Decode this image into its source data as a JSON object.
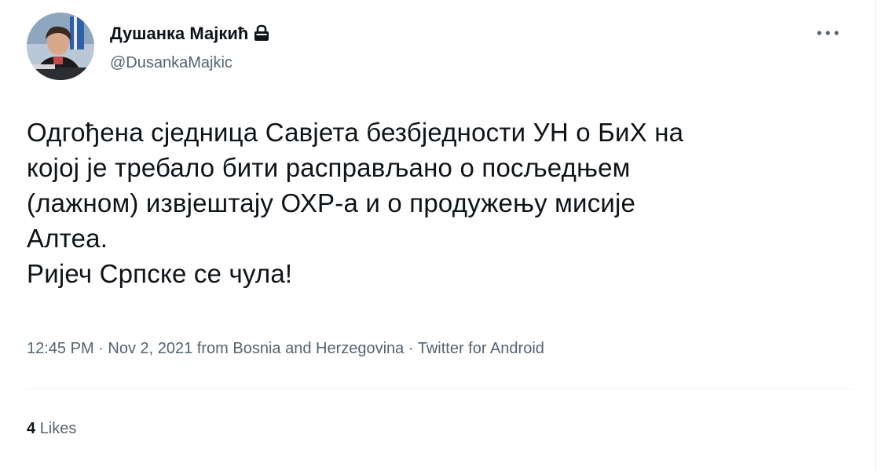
{
  "author": {
    "display_name": "Душанка Мајкић",
    "handle": "@DusankaMajkic",
    "verified_icon": "lock-icon"
  },
  "tweet": {
    "lines": [
      "Одгођена сједница Савјета безбједности УН о БиХ на",
      "којој је требало бити расправљано о посљедњем",
      "(лажном) извјештају ОХР-а и о продужењу мисије",
      "Алтеа.",
      "Ријеч Српске се чула!"
    ]
  },
  "meta": {
    "time": "12:45 PM",
    "separator": " · ",
    "date": "Nov 2, 2021",
    "location_prefix": " from ",
    "location": "Bosnia and Herzegovina",
    "source": "Twitter for Android"
  },
  "stats": {
    "likes_count": "4",
    "likes_label": "Likes"
  },
  "colors": {
    "text_primary": "#0f1419",
    "text_secondary": "#536471",
    "divider": "#eff3f4"
  },
  "icons": {
    "more": "more-options-icon",
    "lock": "lock-icon",
    "avatar": "avatar"
  }
}
